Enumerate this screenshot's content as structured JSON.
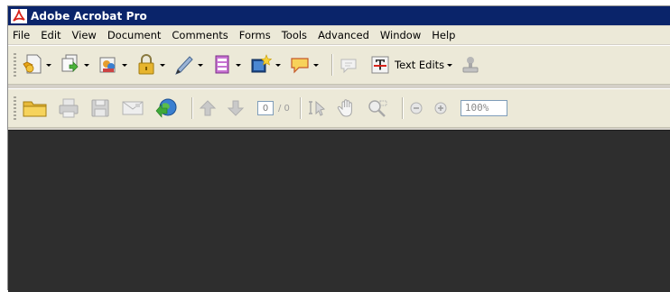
{
  "window": {
    "title": "Adobe Acrobat Pro"
  },
  "menubar": {
    "items": [
      "File",
      "Edit",
      "View",
      "Document",
      "Comments",
      "Forms",
      "Tools",
      "Advanced",
      "Window",
      "Help"
    ]
  },
  "toolbar1": {
    "text_edits_label": "Text Edits"
  },
  "toolbar2": {
    "page_current": "0",
    "page_total": "/ 0",
    "zoom_value": "100%"
  },
  "colors": {
    "titlebar": "#0a246a",
    "toolbar_bg": "#ece9d8",
    "document_bg": "#2e2e2e",
    "acrobat_red": "#d8231a"
  },
  "icons": [
    "acrobat-logo-icon",
    "create-pdf-icon",
    "combine-files-icon",
    "collaborate-icon",
    "secure-lock-icon",
    "sign-pen-icon",
    "forms-icon",
    "multimedia-icon",
    "comment-icon",
    "sticky-note-icon",
    "text-edits-icon",
    "stamp-icon",
    "open-folder-icon",
    "print-icon",
    "save-icon",
    "email-icon",
    "web-globe-icon",
    "previous-page-icon",
    "next-page-icon",
    "select-tool-icon",
    "hand-tool-icon",
    "marquee-zoom-icon",
    "zoom-out-icon",
    "zoom-in-icon"
  ]
}
